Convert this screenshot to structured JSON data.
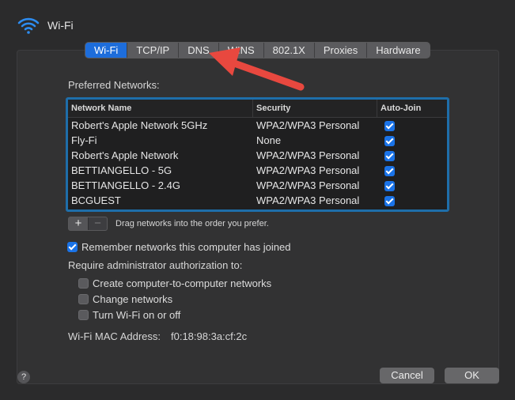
{
  "window": {
    "title": "Wi-Fi",
    "icon": "wifi-icon"
  },
  "tabs": [
    {
      "label": "Wi-Fi",
      "active": true
    },
    {
      "label": "TCP/IP",
      "active": false
    },
    {
      "label": "DNS",
      "active": false
    },
    {
      "label": "WINS",
      "active": false
    },
    {
      "label": "802.1X",
      "active": false
    },
    {
      "label": "Proxies",
      "active": false
    },
    {
      "label": "Hardware",
      "active": false
    }
  ],
  "preferred_networks": {
    "label": "Preferred Networks:",
    "columns": [
      "Network Name",
      "Security",
      "Auto-Join"
    ],
    "rows": [
      {
        "name": "Robert's Apple Network 5GHz",
        "security": "WPA2/WPA3 Personal",
        "auto_join": true
      },
      {
        "name": "Fly-Fi",
        "security": "None",
        "auto_join": true
      },
      {
        "name": "Robert's Apple Network",
        "security": "WPA2/WPA3 Personal",
        "auto_join": true
      },
      {
        "name": "BETTIANGELLO - 5G",
        "security": "WPA2/WPA3 Personal",
        "auto_join": true
      },
      {
        "name": "BETTIANGELLO - 2.4G",
        "security": "WPA2/WPA3 Personal",
        "auto_join": true
      },
      {
        "name": "BCGUEST",
        "security": "WPA2/WPA3 Personal",
        "auto_join": true
      }
    ],
    "add_label": "+",
    "remove_label": "−",
    "hint": "Drag networks into the order you prefer."
  },
  "remember": {
    "label": "Remember networks this computer has joined",
    "checked": true
  },
  "admin": {
    "label": "Require administrator authorization to:",
    "options": [
      {
        "label": "Create computer-to-computer networks",
        "checked": false
      },
      {
        "label": "Change networks",
        "checked": false
      },
      {
        "label": "Turn Wi-Fi on or off",
        "checked": false
      }
    ]
  },
  "mac": {
    "label": "Wi-Fi MAC Address:",
    "value": "f0:18:98:3a:cf:2c"
  },
  "footer": {
    "help_label": "?",
    "cancel_label": "Cancel",
    "ok_label": "OK"
  },
  "colors": {
    "accent": "#1d6ddb",
    "annotation_arrow": "#e8483f"
  }
}
